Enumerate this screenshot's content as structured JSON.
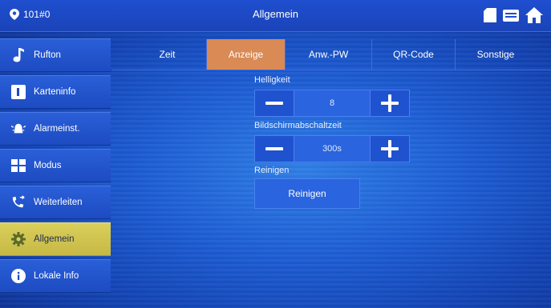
{
  "header": {
    "room": "101#0",
    "title": "Allgemein"
  },
  "sidebar": {
    "items": [
      {
        "label": "Rufton",
        "icon": "music-note-icon"
      },
      {
        "label": "Karteninfo",
        "icon": "card-icon"
      },
      {
        "label": "Alarmeinst.",
        "icon": "alarm-icon"
      },
      {
        "label": "Modus",
        "icon": "modes-icon"
      },
      {
        "label": "Weiterleiten",
        "icon": "forward-call-icon"
      },
      {
        "label": "Allgemein",
        "icon": "gear-icon",
        "active": true
      },
      {
        "label": "Lokale Info",
        "icon": "info-icon"
      }
    ]
  },
  "tabs": [
    {
      "label": "Zeit"
    },
    {
      "label": "Anzeige",
      "active": true
    },
    {
      "label": "Anw.-PW"
    },
    {
      "label": "QR-Code"
    },
    {
      "label": "Sonstige"
    }
  ],
  "settings": {
    "brightness_label": "Helligkeit",
    "brightness_value": "8",
    "screen_off_label": "Bildschirmabschaltzeit",
    "screen_off_value": "300s",
    "clean_label": "Reinigen",
    "clean_button": "Reinigen"
  },
  "colors": {
    "active_sidebar": "#d9cf5a",
    "active_tab": "#d98a55",
    "background": "#1e5fd6"
  }
}
